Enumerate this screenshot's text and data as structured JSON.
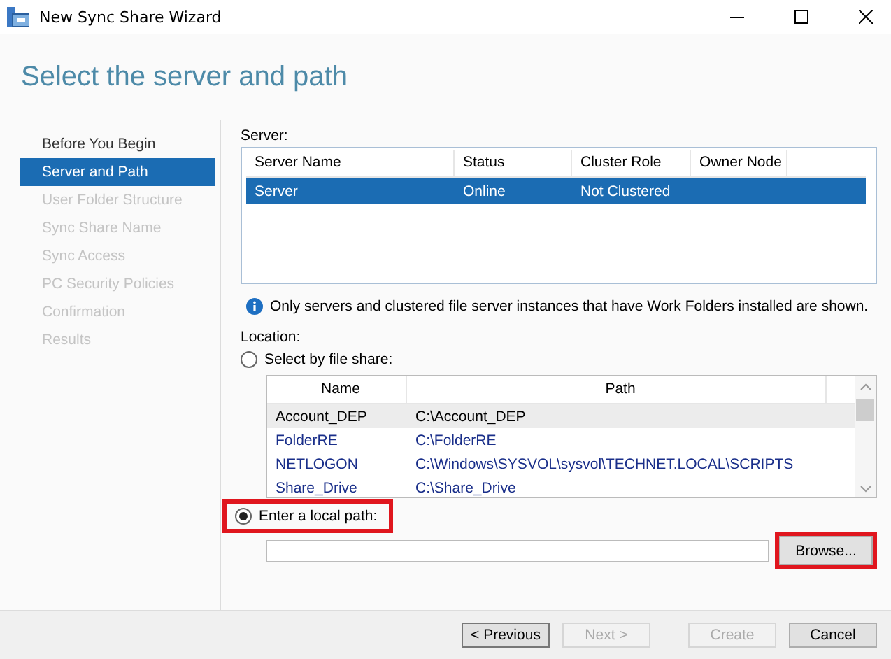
{
  "window": {
    "title": "New Sync Share Wizard"
  },
  "heading": "Select the server and path",
  "sidebar": {
    "items": [
      {
        "label": "Before You Begin",
        "selected": false,
        "disabled": false
      },
      {
        "label": "Server and Path",
        "selected": true,
        "disabled": false
      },
      {
        "label": "User Folder Structure",
        "selected": false,
        "disabled": true
      },
      {
        "label": "Sync Share Name",
        "selected": false,
        "disabled": true
      },
      {
        "label": "Sync Access",
        "selected": false,
        "disabled": true
      },
      {
        "label": "PC Security Policies",
        "selected": false,
        "disabled": true
      },
      {
        "label": "Confirmation",
        "selected": false,
        "disabled": true
      },
      {
        "label": "Results",
        "selected": false,
        "disabled": true
      }
    ]
  },
  "server": {
    "label": "Server:",
    "columns": [
      "Server Name",
      "Status",
      "Cluster Role",
      "Owner Node"
    ],
    "rows": [
      {
        "cells": [
          "Server",
          "Online",
          "Not Clustered",
          ""
        ],
        "selected": true
      }
    ]
  },
  "info": "Only servers and clustered file server instances that have Work Folders installed are shown.",
  "location": {
    "label": "Location:",
    "options": [
      {
        "label": "Select by file share:",
        "selected": false,
        "highlighted": false
      },
      {
        "label": "Enter a local path:",
        "selected": true,
        "highlighted": true
      }
    ],
    "shares": {
      "columns": [
        "Name",
        "Path"
      ],
      "rows": [
        {
          "cells": [
            "Account_DEP",
            "C:\\Account_DEP"
          ],
          "selected": true
        },
        {
          "cells": [
            "FolderRE",
            "C:\\FolderRE"
          ],
          "selected": false
        },
        {
          "cells": [
            "NETLOGON",
            "C:\\Windows\\SYSVOL\\sysvol\\TECHNET.LOCAL\\SCRIPTS"
          ],
          "selected": false
        },
        {
          "cells": [
            "Share_Drive",
            "C:\\Share_Drive"
          ],
          "selected": false
        }
      ]
    },
    "browse": {
      "label": "Browse...",
      "highlighted": true
    }
  },
  "buttons": [
    {
      "label": "< Previous",
      "disabled": false
    },
    {
      "label": "Next >",
      "disabled": true
    },
    {
      "label": "Create",
      "disabled": true
    },
    {
      "label": "Cancel",
      "disabled": false
    }
  ]
}
